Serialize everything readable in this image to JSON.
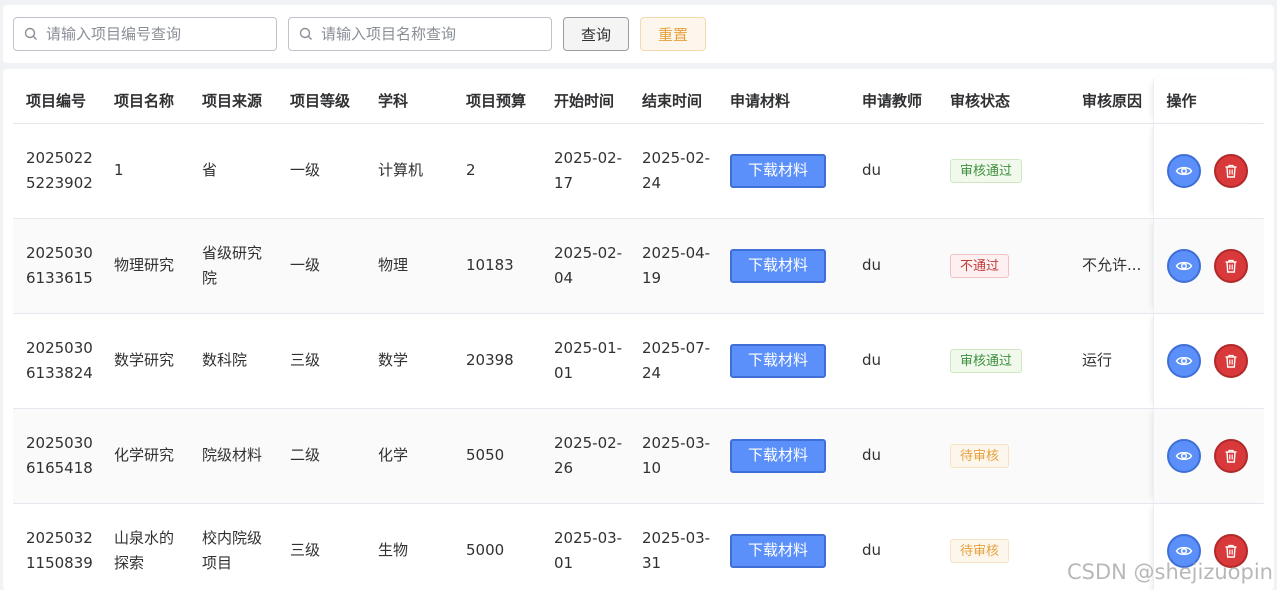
{
  "search": {
    "code_placeholder": "请输入项目编号查询",
    "name_placeholder": "请输入项目名称查询",
    "query_label": "查询",
    "reset_label": "重置"
  },
  "table": {
    "headers": [
      "项目编号",
      "项目名称",
      "项目来源",
      "项目等级",
      "学科",
      "项目预算",
      "开始时间",
      "结束时间",
      "申请材料",
      "申请教师",
      "审核状态",
      "审核原因",
      "操作"
    ],
    "download_label": "下载材料",
    "rows": [
      {
        "code": "20250225223902",
        "name": "1",
        "source": "省",
        "level": "一级",
        "subject": "计算机",
        "budget": "2",
        "start": "2025-02-17",
        "end": "2025-02-24",
        "teacher": "du",
        "status": "审核通过",
        "status_type": "success",
        "reason": ""
      },
      {
        "code": "20250306133615",
        "name": "物理研究",
        "source": "省级研究院",
        "level": "一级",
        "subject": "物理",
        "budget": "10183",
        "start": "2025-02-04",
        "end": "2025-04-19",
        "teacher": "du",
        "status": "不通过",
        "status_type": "danger",
        "reason": "不允许..."
      },
      {
        "code": "20250306133824",
        "name": "数学研究",
        "source": "数科院",
        "level": "三级",
        "subject": "数学",
        "budget": "20398",
        "start": "2025-01-01",
        "end": "2025-07-24",
        "teacher": "du",
        "status": "审核通过",
        "status_type": "success",
        "reason": "运行"
      },
      {
        "code": "20250306165418",
        "name": "化学研究",
        "source": "院级材料",
        "level": "二级",
        "subject": "化学",
        "budget": "5050",
        "start": "2025-02-26",
        "end": "2025-03-10",
        "teacher": "du",
        "status": "待审核",
        "status_type": "warning",
        "reason": ""
      },
      {
        "code": "20250321150839",
        "name": "山泉水的探索",
        "source": "校内院级项目",
        "level": "三级",
        "subject": "生物",
        "budget": "5000",
        "start": "2025-03-01",
        "end": "2025-03-31",
        "teacher": "du",
        "status": "待审核",
        "status_type": "warning",
        "reason": ""
      }
    ]
  },
  "watermark": "CSDN @shejizuopin",
  "colors": {
    "primary": "#5b8ff9",
    "danger": "#d9393a",
    "success": "#3e8f3e",
    "warning": "#e6a23c"
  }
}
